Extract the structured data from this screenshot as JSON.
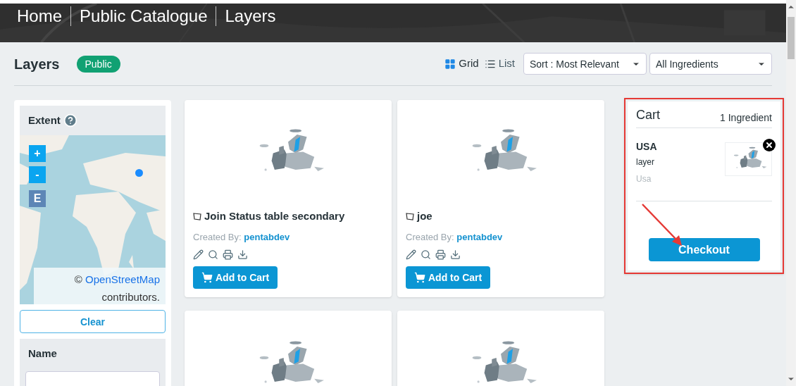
{
  "breadcrumb": [
    "Home",
    "Public Catalogue",
    "Layers"
  ],
  "header": {
    "title": "Layers",
    "badge": "Public",
    "views": [
      {
        "label": "Grid",
        "kind": "grid",
        "selected": true
      },
      {
        "label": "List",
        "kind": "list",
        "selected": false
      }
    ],
    "sort": "Sort : Most Relevant",
    "filter": "All Ingredients"
  },
  "sidebar": {
    "extent_title": "Extent",
    "map_controls": [
      "+",
      "-",
      "E"
    ],
    "attribution_prefix": "©",
    "attribution_link": "OpenStreetMap",
    "attribution_suffix": "contributors.",
    "clear": "Clear",
    "name_title": "Name"
  },
  "cards": [
    {
      "kind": "layer",
      "title": "Join Status table secondary",
      "created_by_label": "Created By:",
      "author": "pentabdev",
      "button": "Add to Cart"
    },
    {
      "kind": "layer",
      "title": "joe",
      "created_by_label": "Created By:",
      "author": "pentabdev",
      "button": "Add to Cart"
    },
    {
      "kind": "picture"
    },
    {
      "kind": "picture"
    }
  ],
  "cart": {
    "title": "Cart",
    "count": "1 Ingredient",
    "items": [
      {
        "name": "USA",
        "type": "layer",
        "subtitle": "Usa"
      }
    ],
    "checkout": "Checkout"
  }
}
